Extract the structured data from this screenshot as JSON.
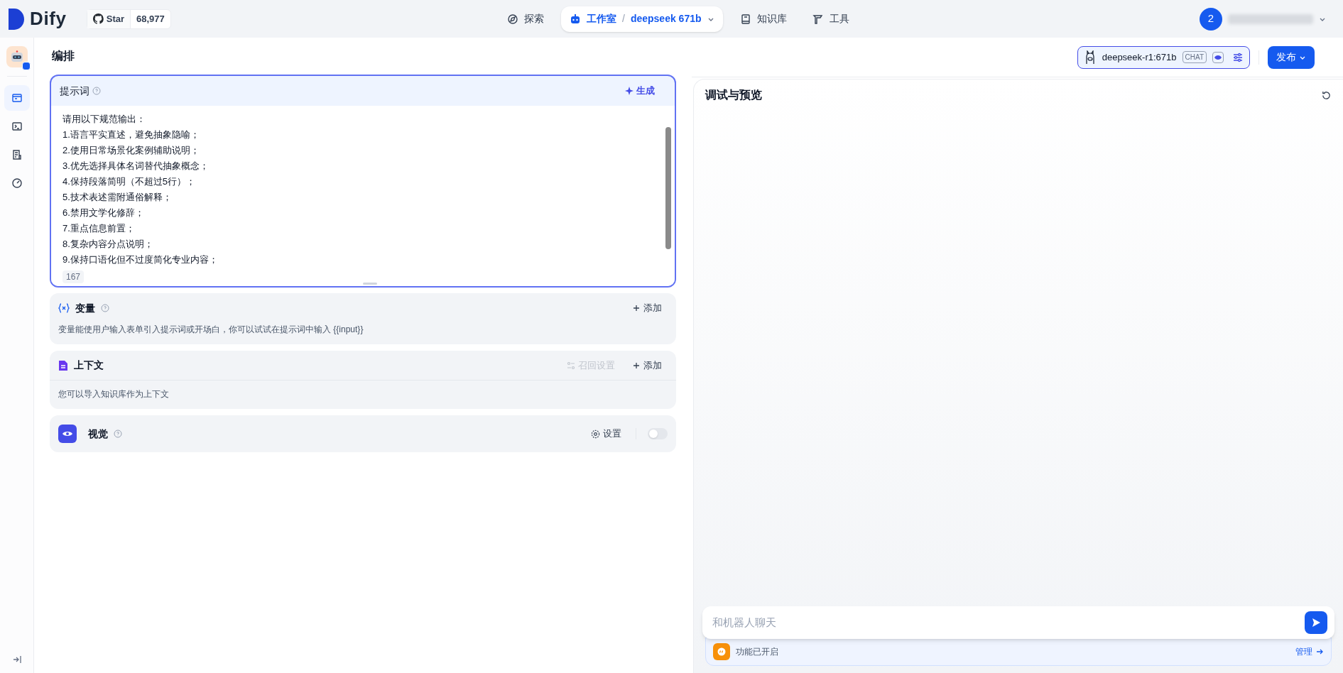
{
  "top_bar": {
    "logo": "Dify",
    "github": {
      "label": "Star",
      "count": "68,977"
    },
    "nav": [
      {
        "label": "探索",
        "kind": "explore",
        "selected": false
      },
      {
        "label": "工作室",
        "kind": "studio",
        "selected": true,
        "separator": "/",
        "app": "deepseek 671b"
      },
      {
        "label": "知识库",
        "kind": "knowledge",
        "selected": false
      },
      {
        "label": "工具",
        "kind": "tools",
        "selected": false
      }
    ],
    "avatar": "2"
  },
  "sidebar": {
    "items": [
      {
        "kind": "layout",
        "selected": true
      },
      {
        "kind": "terminal",
        "selected": false
      },
      {
        "kind": "logs",
        "selected": false
      },
      {
        "kind": "monitor",
        "selected": false
      }
    ]
  },
  "editor": {
    "title": "编排",
    "prompt": {
      "title": "提示词",
      "generate": "生成",
      "lines": [
        "请用以下规范输出：",
        "1.语言平实直述，避免抽象隐喻；",
        "2.使用日常场景化案例辅助说明；",
        "3.优先选择具体名词替代抽象概念；",
        "4.保持段落简明（不超过5行）；",
        "5.技术表述需附通俗解释；",
        "6.禁用文学化修辞；",
        "7.重点信息前置；",
        "8.复杂内容分点说明；",
        "9.保持口语化但不过度简化专业内容；"
      ],
      "count": "167"
    },
    "variables": {
      "title": "变量",
      "add": "添加",
      "description": "变量能使用户输入表单引入提示词或开场白，你可以试试在提示词中输入 {{input}}"
    },
    "context": {
      "title": "上下文",
      "retrieval": "召回设置",
      "add": "添加",
      "description": "您可以导入知识库作为上下文"
    },
    "vision": {
      "title": "视觉",
      "settings": "设置",
      "on": false
    }
  },
  "model": {
    "name": "deepseek-r1:671b",
    "mode": "CHAT"
  },
  "publish": "发布",
  "debug": {
    "title": "调试与预览",
    "input_placeholder": "和机器人聊天",
    "features": "功能已开启",
    "manage": "管理"
  }
}
